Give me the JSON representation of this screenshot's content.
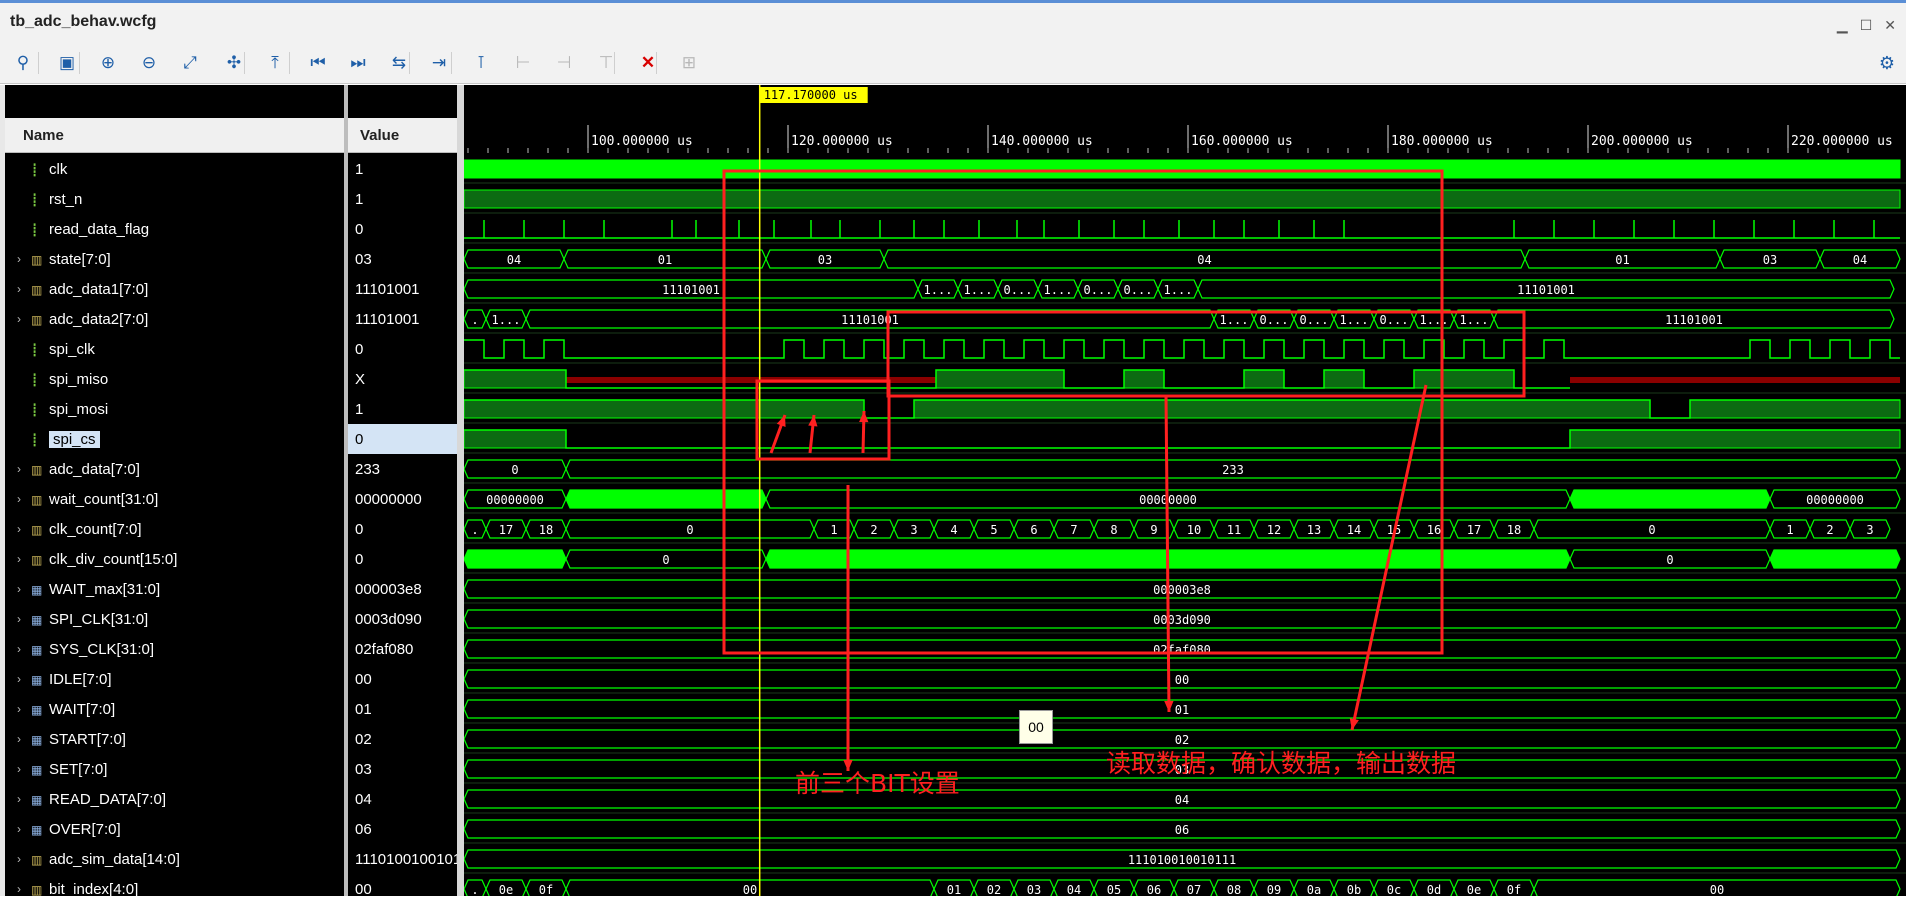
{
  "window": {
    "title": "tb_adc_behav.wcfg",
    "controls": [
      "minimize-icon",
      "restore-icon",
      "close-icon"
    ]
  },
  "toolbar": {
    "tools": [
      {
        "name": "search",
        "glyph": "⚲",
        "enabled": true
      },
      {
        "name": "save",
        "glyph": "▣",
        "enabled": true
      },
      {
        "name": "zoom-in",
        "glyph": "⊕",
        "enabled": true
      },
      {
        "name": "zoom-out",
        "glyph": "⊖",
        "enabled": true
      },
      {
        "name": "zoom-fit",
        "glyph": "⤢",
        "enabled": true
      },
      {
        "name": "go-to-cursor",
        "glyph": "✣",
        "enabled": true
      },
      {
        "name": "previous-transition",
        "glyph": "⤒",
        "enabled": true
      },
      {
        "name": "go-to-time-zero",
        "glyph": "⏮",
        "enabled": true
      },
      {
        "name": "go-to-last-time",
        "glyph": "⏭",
        "enabled": true
      },
      {
        "name": "swap-cursors",
        "glyph": "⇆",
        "enabled": true
      },
      {
        "name": "snap-to-transition",
        "glyph": "⇥",
        "enabled": true
      },
      {
        "name": "add-marker",
        "glyph": "⊺",
        "enabled": true
      },
      {
        "name": "previous-marker",
        "glyph": "⊢",
        "enabled": false
      },
      {
        "name": "next-marker",
        "glyph": "⊣",
        "enabled": false
      },
      {
        "name": "marker-settings",
        "glyph": "⊤",
        "enabled": false
      },
      {
        "name": "delete-all-markers",
        "glyph": "✕",
        "enabled": true,
        "accent": "#d80000"
      },
      {
        "name": "floating-ruler",
        "glyph": "⊞",
        "enabled": false
      }
    ],
    "settings_icon": "gear-icon"
  },
  "columns": {
    "name": "Name",
    "value": "Value"
  },
  "signals": [
    {
      "name": "clk",
      "value": "1",
      "kind": "bit",
      "expandable": false
    },
    {
      "name": "rst_n",
      "value": "1",
      "kind": "bit",
      "expandable": false
    },
    {
      "name": "read_data_flag",
      "value": "0",
      "kind": "bit",
      "expandable": false
    },
    {
      "name": "state[7:0]",
      "value": "03",
      "kind": "bus",
      "expandable": true
    },
    {
      "name": "adc_data1[7:0]",
      "value": "11101001",
      "kind": "bus",
      "expandable": true
    },
    {
      "name": "adc_data2[7:0]",
      "value": "11101001",
      "kind": "bus",
      "expandable": true
    },
    {
      "name": "spi_clk",
      "value": "0",
      "kind": "bit",
      "expandable": false
    },
    {
      "name": "spi_miso",
      "value": "X",
      "kind": "bit",
      "expandable": false
    },
    {
      "name": "spi_mosi",
      "value": "1",
      "kind": "bit",
      "expandable": false
    },
    {
      "name": "spi_cs",
      "value": "0",
      "kind": "bit",
      "expandable": false,
      "selected": true
    },
    {
      "name": "adc_data[7:0]",
      "value": "233",
      "kind": "bus",
      "expandable": true
    },
    {
      "name": "wait_count[31:0]",
      "value": "00000000",
      "kind": "bus",
      "expandable": true
    },
    {
      "name": "clk_count[7:0]",
      "value": "0",
      "kind": "bus",
      "expandable": true
    },
    {
      "name": "clk_div_count[15:0]",
      "value": "0",
      "kind": "bus",
      "expandable": true
    },
    {
      "name": "WAIT_max[31:0]",
      "value": "000003e8",
      "kind": "param",
      "expandable": true
    },
    {
      "name": "SPI_CLK[31:0]",
      "value": "0003d090",
      "kind": "param",
      "expandable": true
    },
    {
      "name": "SYS_CLK[31:0]",
      "value": "02faf080",
      "kind": "param",
      "expandable": true
    },
    {
      "name": "IDLE[7:0]",
      "value": "00",
      "kind": "param",
      "expandable": true
    },
    {
      "name": "WAIT[7:0]",
      "value": "01",
      "kind": "param",
      "expandable": true
    },
    {
      "name": "START[7:0]",
      "value": "02",
      "kind": "param",
      "expandable": true
    },
    {
      "name": "SET[7:0]",
      "value": "03",
      "kind": "param",
      "expandable": true
    },
    {
      "name": "READ_DATA[7:0]",
      "value": "04",
      "kind": "param",
      "expandable": true
    },
    {
      "name": "OVER[7:0]",
      "value": "06",
      "kind": "param",
      "expandable": true
    },
    {
      "name": "adc_sim_data[14:0]",
      "value": "111010010010111",
      "kind": "bus",
      "expandable": true
    },
    {
      "name": "bit_index[4:0]",
      "value": "00",
      "kind": "bus",
      "expandable": true
    }
  ],
  "timeline": {
    "cursor_time": "117.170000 us",
    "ticks": [
      "100.000000 us",
      "120.000000 us",
      "140.000000 us",
      "160.000000 us",
      "180.000000 us",
      "200.000000 us",
      "220.000000 us"
    ]
  },
  "waves": {
    "state": [
      "04",
      "01",
      "03",
      "04",
      "01",
      "03",
      "04"
    ],
    "adc_data1": [
      "11101001",
      "1...",
      "1...",
      "0...",
      "1...",
      "0...",
      "0...",
      "1...",
      "11101001"
    ],
    "adc_data2": [
      ".",
      "1...",
      "11101001",
      "1...",
      "0...",
      "0...",
      "1...",
      "0...",
      "1...",
      "1...",
      "11101001"
    ],
    "adc_data": [
      "0",
      "233"
    ],
    "wait_count": [
      "00000000",
      "00000000",
      "00000000"
    ],
    "clk_count": [
      ".",
      "17",
      "18",
      "0",
      "1",
      "2",
      "3",
      "4",
      "5",
      "6",
      "7",
      "8",
      "9",
      "10",
      "11",
      "12",
      "13",
      "14",
      "15",
      "16",
      "17",
      "18",
      "0",
      "1",
      "2",
      "3"
    ],
    "clk_div_count": [
      "0",
      "0"
    ],
    "WAIT_max": "000003e8",
    "SPI_CLK": "0003d090",
    "SYS_CLK": "02faf080",
    "IDLE": "00",
    "WAIT": "01",
    "START": "02",
    "SET": "03",
    "READ_DATA": "04",
    "OVER": "06",
    "adc_sim_data": "111010010010111",
    "bit_index": [
      ".",
      "0e",
      "0f",
      "00",
      "01",
      "02",
      "03",
      "04",
      "05",
      "06",
      "07",
      "08",
      "09",
      "0a",
      "0b",
      "0c",
      "0d",
      "0e",
      "0f",
      "00"
    ]
  },
  "tooltip": "00",
  "annotations": {
    "first_three_bits": "前三个BIT设置",
    "read_confirm_output": "读取数据，确认数据，输出数据"
  },
  "colors": {
    "wave_green": "#00ff00",
    "bus_dark_green": "#0c6b12",
    "x_red": "#8b0000",
    "cursor_yellow": "#ffff00",
    "annotation_red": "#ff2020",
    "selection": "#d4e4f5"
  }
}
